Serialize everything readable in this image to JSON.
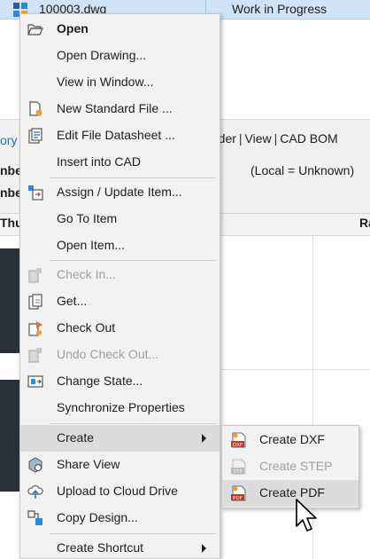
{
  "background": {
    "top_row": {
      "filename": "100003.dwg",
      "status": "Work in Progress"
    },
    "fragment_left": "ory",
    "links": [
      "rder",
      "View",
      "CAD BOM"
    ],
    "local_note": "(Local = Unknown)",
    "row_labels": [
      "nbe",
      "nbe"
    ],
    "column_headers": {
      "thumb": "Thu",
      "right": "Ra"
    }
  },
  "context_menu": {
    "items": [
      {
        "label": "Open",
        "icon": "folder-open-icon"
      },
      {
        "label": "Open Drawing...",
        "icon": ""
      },
      {
        "label": "View in Window...",
        "icon": ""
      },
      {
        "label": "New Standard File ...",
        "icon": "new-standard-file-icon"
      },
      {
        "label": "Edit File Datasheet ...",
        "icon": "datasheet-icon"
      },
      {
        "label": "Insert into CAD",
        "icon": ""
      },
      {
        "label": "Assign / Update Item...",
        "icon": "assign-item-icon"
      },
      {
        "label": "Go To Item",
        "icon": ""
      },
      {
        "label": "Open Item...",
        "icon": ""
      },
      {
        "label": "Check In...",
        "icon": "check-in-icon"
      },
      {
        "label": "Get...",
        "icon": "get-icon"
      },
      {
        "label": "Check Out",
        "icon": "check-out-icon"
      },
      {
        "label": "Undo Check Out...",
        "icon": "undo-check-out-icon"
      },
      {
        "label": "Change State...",
        "icon": "change-state-icon"
      },
      {
        "label": "Synchronize Properties",
        "icon": ""
      },
      {
        "label": "Create",
        "icon": ""
      },
      {
        "label": "Share View",
        "icon": "share-view-icon"
      },
      {
        "label": "Upload to Cloud Drive",
        "icon": "cloud-upload-icon"
      },
      {
        "label": "Copy Design...",
        "icon": "copy-design-icon"
      },
      {
        "label": "Create Shortcut",
        "icon": ""
      }
    ]
  },
  "create_submenu": {
    "items": [
      {
        "label": "Create DXF",
        "icon": "dxf-file-icon",
        "badge": "DXF"
      },
      {
        "label": "Create STEP",
        "icon": "step-file-icon",
        "badge": "STP"
      },
      {
        "label": "Create PDF",
        "icon": "pdf-file-icon",
        "badge": "PDF"
      }
    ]
  },
  "colors": {
    "menu_background": "#f2f2f2",
    "highlight": "#dcdcdc",
    "selected_row": "#cfe3f7",
    "disabled_text": "#a0a0a0",
    "link_blue": "#2a6fb7"
  }
}
